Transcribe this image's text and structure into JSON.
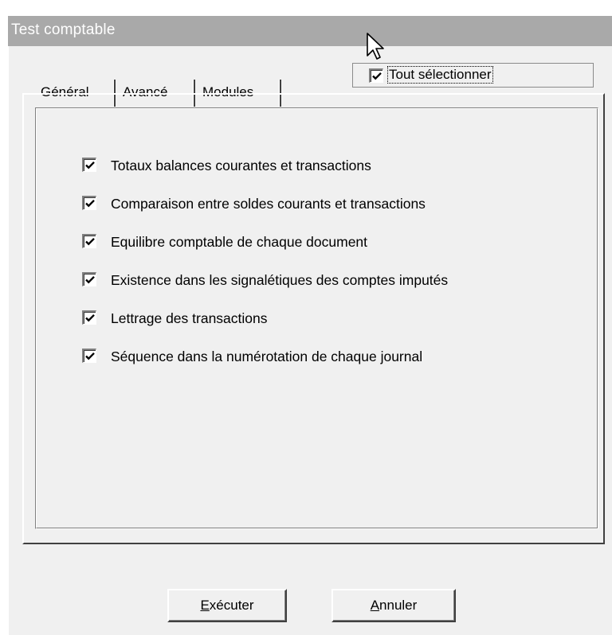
{
  "window": {
    "title": "Test comptable"
  },
  "tabs": [
    {
      "label": "Général",
      "selected": true
    },
    {
      "label": "Avancé",
      "selected": false
    },
    {
      "label": "Modules",
      "selected": false
    }
  ],
  "select_all": {
    "label": "Tout sélectionner",
    "checked": true
  },
  "options": [
    {
      "label": "Totaux balances courantes et transactions",
      "checked": true
    },
    {
      "label": "Comparaison entre soldes courants et transactions",
      "checked": true
    },
    {
      "label": "Equilibre comptable de chaque document",
      "checked": true
    },
    {
      "label": "Existence dans les signalétiques des comptes imputés",
      "checked": true
    },
    {
      "label": "Lettrage des transactions",
      "checked": true
    },
    {
      "label": "Séquence dans la numérotation de chaque journal",
      "checked": true
    }
  ],
  "buttons": {
    "execute": {
      "accel": "E",
      "rest": "xécuter"
    },
    "cancel": {
      "accel": "A",
      "rest": "nnuler"
    }
  },
  "icons": {
    "checkmark": "checkmark-icon",
    "cursor": "mouse-pointer-icon"
  },
  "colors": {
    "titlebar": "#a9a9a9",
    "title_text": "#ffffff",
    "dialog_bg": "#f0f0f0"
  }
}
